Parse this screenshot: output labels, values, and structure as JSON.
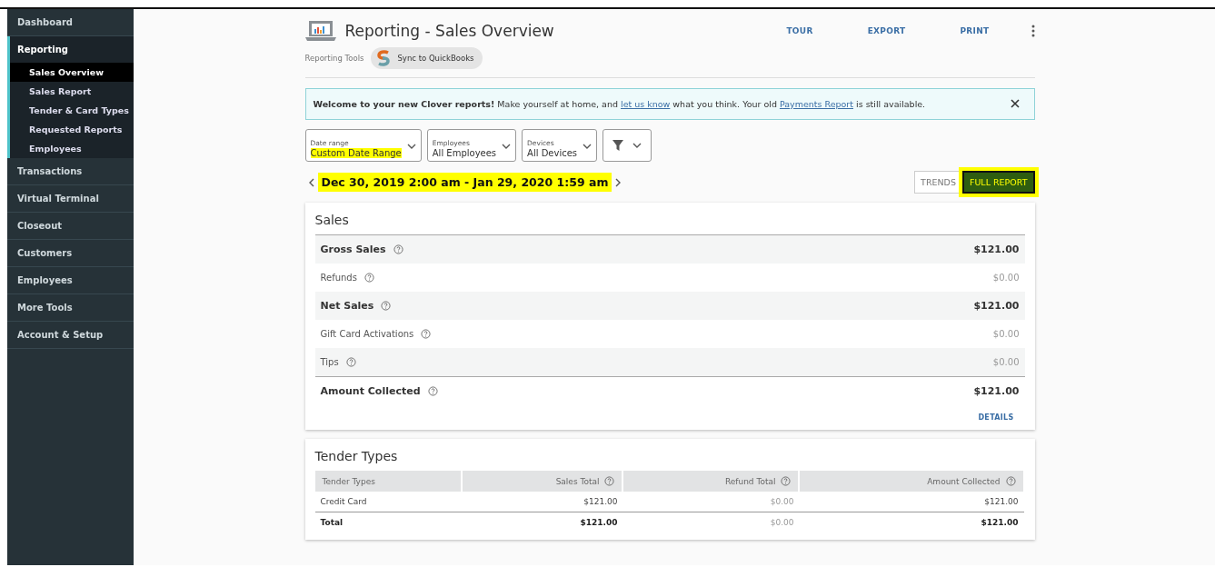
{
  "sidebar": {
    "items": [
      {
        "label": "Dashboard",
        "expanded": false
      },
      {
        "label": "Reporting",
        "expanded": true,
        "children": [
          {
            "label": "Sales Overview",
            "selected": true
          },
          {
            "label": "Sales Report",
            "selected": false
          },
          {
            "label": "Tender & Card Types",
            "selected": false
          },
          {
            "label": "Requested Reports",
            "selected": false
          },
          {
            "label": "Employees",
            "selected": false
          }
        ]
      },
      {
        "label": "Transactions",
        "expanded": false
      },
      {
        "label": "Virtual Terminal",
        "expanded": false
      },
      {
        "label": "Closeout",
        "expanded": false
      },
      {
        "label": "Customers",
        "expanded": false
      },
      {
        "label": "Employees",
        "expanded": false
      },
      {
        "label": "More Tools",
        "expanded": false
      },
      {
        "label": "Account & Setup",
        "expanded": false
      }
    ]
  },
  "header": {
    "title": "Reporting - Sales Overview",
    "actions": [
      "TOUR",
      "EXPORT",
      "PRINT"
    ],
    "tools_label": "Reporting Tools",
    "tool_chip": "Sync to QuickBooks"
  },
  "banner": {
    "text": "**Welcome to your new Clover reports!** Make yourself at home, and ",
    "link1": "let us know",
    "middle": " what you think. Your old ",
    "link2": "Payments Report",
    "end": " is still available."
  },
  "filters": [
    {
      "kind": "select",
      "label": "Date range",
      "value": "Custom Date Range",
      "highlighted": true
    },
    {
      "kind": "select",
      "label": "Employees",
      "value": "All Employees",
      "highlighted": false
    },
    {
      "kind": "select",
      "label": "Devices",
      "value": "All Devices",
      "highlighted": false
    },
    {
      "kind": "filter"
    }
  ],
  "date_range": {
    "text": "Dec 30, 2019 2:00 am - Jan 29, 2020 1:59 am",
    "highlighted": true
  },
  "view_toggle": [
    {
      "label": "TRENDS",
      "selected": false,
      "highlighted": false
    },
    {
      "label": "FULL REPORT",
      "selected": true,
      "highlighted": true
    }
  ],
  "sales": {
    "title": "Sales",
    "rows": [
      {
        "label": "Gross Sales",
        "value": "$121.00",
        "bold": true
      },
      {
        "label": "Refunds",
        "value": "$0.00",
        "bold": false
      },
      {
        "label": "Net Sales",
        "value": "$121.00",
        "bold": true
      },
      {
        "label": "Gift Card Activations",
        "value": "$0.00",
        "bold": false
      },
      {
        "label": "Tips",
        "value": "$0.00",
        "bold": false
      },
      {
        "label": "Amount Collected",
        "value": "$121.00",
        "bold": true
      }
    ],
    "details": "DETAILS"
  },
  "tender_types": {
    "title": "Tender Types",
    "columns": [
      "Tender Types",
      "Sales Total",
      "Refund Total",
      "Amount Collected"
    ],
    "rows": [
      {
        "cells": [
          "Credit Card",
          "$121.00",
          "$0.00",
          "$121.00"
        ],
        "bold": false
      },
      {
        "cells": [
          "Total",
          "$121.00",
          "$0.00",
          "$121.00"
        ],
        "bold": true
      }
    ]
  }
}
